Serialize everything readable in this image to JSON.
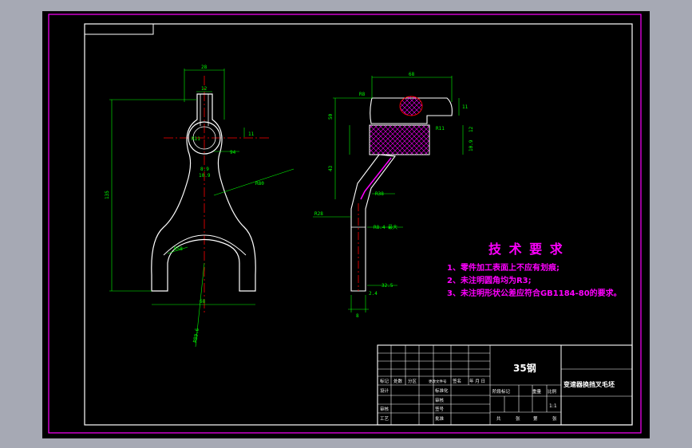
{
  "colors": {
    "viewport_bg": "#a6a9b4",
    "drawing_bg": "#000000",
    "sheet_border": "#ff00ff",
    "outline": "#ffffff",
    "dimension": "#00ff00",
    "center_line": "#ff0000",
    "hatch": "#ff00ff",
    "note_text": "#ff00ff"
  },
  "notes": {
    "title": "技 术 要 求",
    "items": [
      "1、零件加工表面上不应有划痕;",
      "2、未注明圆角均为R3;",
      "3、未注明形状公差应符合GB1184-80的要求。"
    ]
  },
  "title_block": {
    "material": "35钢",
    "part_name": "变速器换挡叉毛坯",
    "scale": "1:1",
    "row_labels": [
      "标记",
      "处数",
      "分区",
      "更改文件号",
      "签名",
      "年 月 日"
    ],
    "left_labels": [
      "设计",
      "审核",
      "工艺"
    ],
    "mid_labels": [
      "标准化",
      "审核",
      "批准",
      "签号"
    ],
    "stage_labels": [
      "阶段标记",
      "重量",
      "比例"
    ],
    "sheet_labels": [
      "共",
      "张",
      "第",
      "张"
    ]
  },
  "dimensions": {
    "front": [
      "28",
      "12",
      "R11",
      "11",
      "94",
      "8.9",
      "10.9",
      "R80",
      "135",
      "R58",
      "68",
      "R89.6"
    ],
    "side": [
      "68",
      "R8",
      "11",
      "50",
      "R11",
      "12",
      "10.9",
      "R38",
      "43",
      "R28",
      "2.4",
      "32.5",
      "8",
      "R8.4 最大"
    ]
  }
}
